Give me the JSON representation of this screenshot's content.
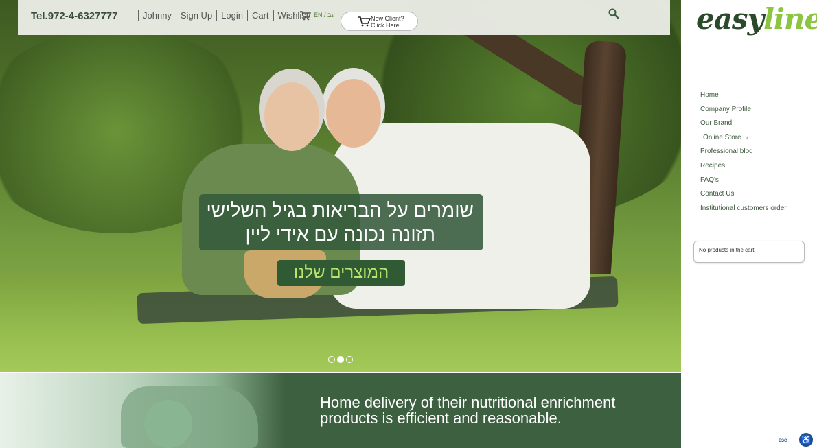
{
  "header": {
    "phone": "Tel.972-4-6327777",
    "links": [
      "Johnny",
      "Sign Up",
      "Login",
      "Cart",
      "Wishlist"
    ],
    "language": "EN / עב",
    "new_client": {
      "line1": "New Client?",
      "line2": "Click Here"
    }
  },
  "hero": {
    "tagline_line1": "שומרים על הבריאות בגיל השלישי",
    "tagline_line2": "תזונה נכונה עם אידי ליין",
    "button_label": "המוצרים שלנו",
    "slides": 3,
    "active_slide": 2
  },
  "brand": {
    "part1": "easy",
    "part2": "line"
  },
  "sidebar": {
    "menu": [
      "Home",
      "Company Profile",
      "Our Brand",
      "Online Store",
      "Professional blog",
      "Recipes",
      "FAQ's",
      "Contact Us",
      "Institutional customers order"
    ],
    "cart_status": "No products in the cart."
  },
  "banner": {
    "line1": "Home delivery of their nutritional enrichment",
    "line2": "products is efficient and reasonable."
  },
  "accessibility": {
    "esc_label": "ESC"
  },
  "colors": {
    "brand_dark": "#2b4a2b",
    "brand_light": "#8cc540",
    "banner_green": "#3d6040"
  }
}
